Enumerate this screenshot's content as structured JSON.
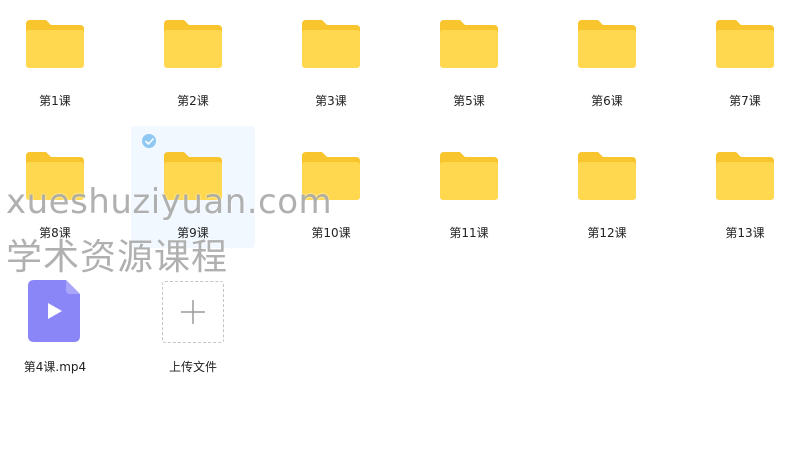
{
  "folders": [
    {
      "label": "第1课"
    },
    {
      "label": "第2课"
    },
    {
      "label": "第3课"
    },
    {
      "label": "第5课"
    },
    {
      "label": "第6课"
    },
    {
      "label": "第7课"
    },
    {
      "label": "第8课"
    },
    {
      "label": "第9课"
    },
    {
      "label": "第10课"
    },
    {
      "label": "第11课"
    },
    {
      "label": "第12课"
    },
    {
      "label": "第13课"
    }
  ],
  "video_file": {
    "label": "第4课.mp4",
    "icon": "video-file-icon"
  },
  "upload": {
    "label": "上传文件",
    "icon": "plus-icon"
  },
  "selected_item": "第9课",
  "watermark": {
    "line1": "xueshuziyuan.com",
    "line2": "学术资源课程"
  },
  "colors": {
    "folder_back": "#f9c52f",
    "folder_front": "#ffd84f",
    "video_icon": "#8a86f7",
    "selection_bg": "#f1f8ff",
    "check": "#8fc8f3"
  }
}
